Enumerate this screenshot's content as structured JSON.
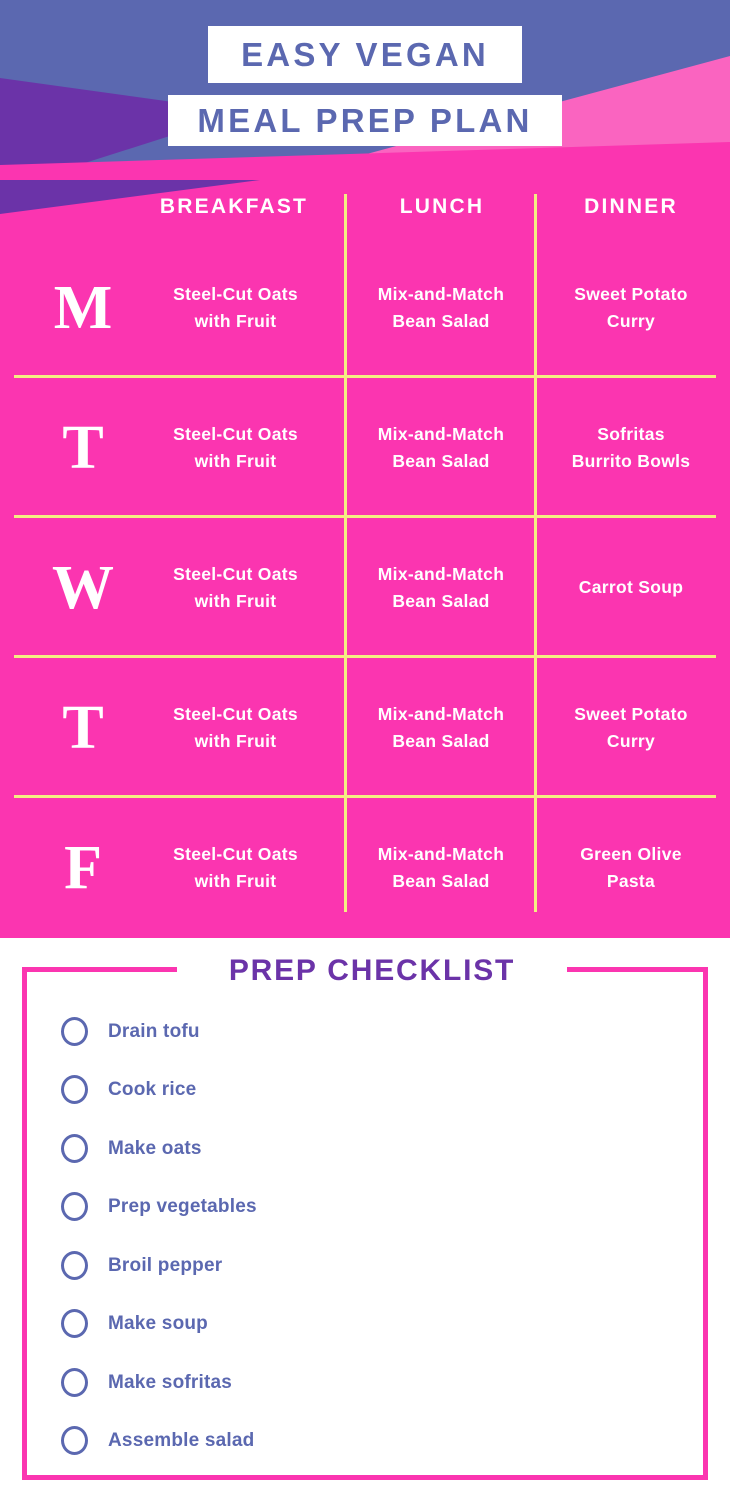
{
  "header": {
    "title_line_1": "EASY VEGAN",
    "title_line_2": "MEAL PREP PLAN",
    "colors": {
      "blue_purple": "#5b68b0",
      "dark_purple": "#6b33a8",
      "hot_pink": "#fb35b0",
      "light_pink": "#fa64c0",
      "white": "#ffffff"
    }
  },
  "table": {
    "columns": [
      "BREAKFAST",
      "LUNCH",
      "DINNER"
    ],
    "divider_color": "#f5ee82",
    "rows": [
      {
        "day": "M",
        "breakfast": "Steel-Cut Oats\nwith Fruit",
        "lunch": "Mix-and-Match\nBean Salad",
        "dinner": "Sweet Potato\nCurry"
      },
      {
        "day": "T",
        "breakfast": "Steel-Cut Oats\nwith Fruit",
        "lunch": "Mix-and-Match\nBean Salad",
        "dinner": "Sofritas\nBurrito Bowls"
      },
      {
        "day": "W",
        "breakfast": "Steel-Cut Oats\nwith Fruit",
        "lunch": "Mix-and-Match\nBean Salad",
        "dinner": "Carrot Soup"
      },
      {
        "day": "T",
        "breakfast": "Steel-Cut Oats\nwith Fruit",
        "lunch": "Mix-and-Match\nBean Salad",
        "dinner": "Sweet Potato\nCurry"
      },
      {
        "day": "F",
        "breakfast": "Steel-Cut Oats\nwith Fruit",
        "lunch": "Mix-and-Match\nBean Salad",
        "dinner": "Green Olive\nPasta"
      }
    ]
  },
  "checklist": {
    "title": "PREP CHECKLIST",
    "border_color": "#fb35b0",
    "text_color": "#5b68b0",
    "items": [
      {
        "label": "Drain tofu",
        "checked": false
      },
      {
        "label": "Cook rice",
        "checked": false
      },
      {
        "label": "Make oats",
        "checked": false
      },
      {
        "label": "Prep vegetables",
        "checked": false
      },
      {
        "label": "Broil pepper",
        "checked": false
      },
      {
        "label": "Make soup",
        "checked": false
      },
      {
        "label": "Make sofritas",
        "checked": false
      },
      {
        "label": "Assemble salad",
        "checked": false
      }
    ]
  }
}
